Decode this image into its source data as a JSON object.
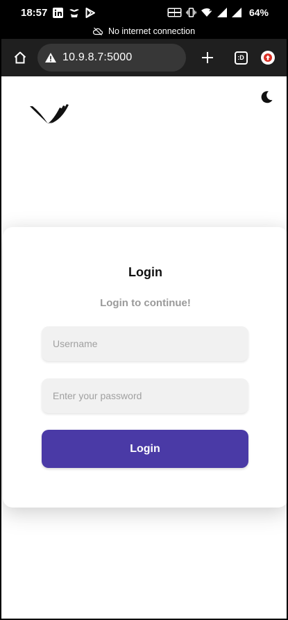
{
  "status_bar": {
    "time": "18:57",
    "battery_percent": "64%",
    "left_icons": [
      "linkedin-icon",
      "notification-icon",
      "play-store-icon"
    ],
    "right_icons": [
      "volte-icon",
      "vibrate-icon",
      "wifi-icon",
      "signal-icon",
      "signal-icon",
      "battery"
    ]
  },
  "network_banner": {
    "text": "No internet connection",
    "icon": "cloud-off-icon"
  },
  "browser": {
    "url": "10.9.8.7:5000",
    "tab_count_label": ":D",
    "icons": [
      "home-icon",
      "warning-icon",
      "plus-icon",
      "tabs-icon",
      "update-icon"
    ]
  },
  "page": {
    "logo_icon": "brand-logo-icon",
    "theme_toggle_icon": "moon-icon",
    "login_card": {
      "title": "Login",
      "subtitle": "Login to continue!",
      "username_placeholder": "Username",
      "password_placeholder": "Enter your password",
      "submit_label": "Login"
    }
  },
  "colors": {
    "primary_button": "#4a3aa6",
    "input_background": "#f1f1f1",
    "subtitle_text": "#9a9a9a",
    "toolbar_background": "#1f1f1f",
    "url_bar_background": "#373737"
  }
}
